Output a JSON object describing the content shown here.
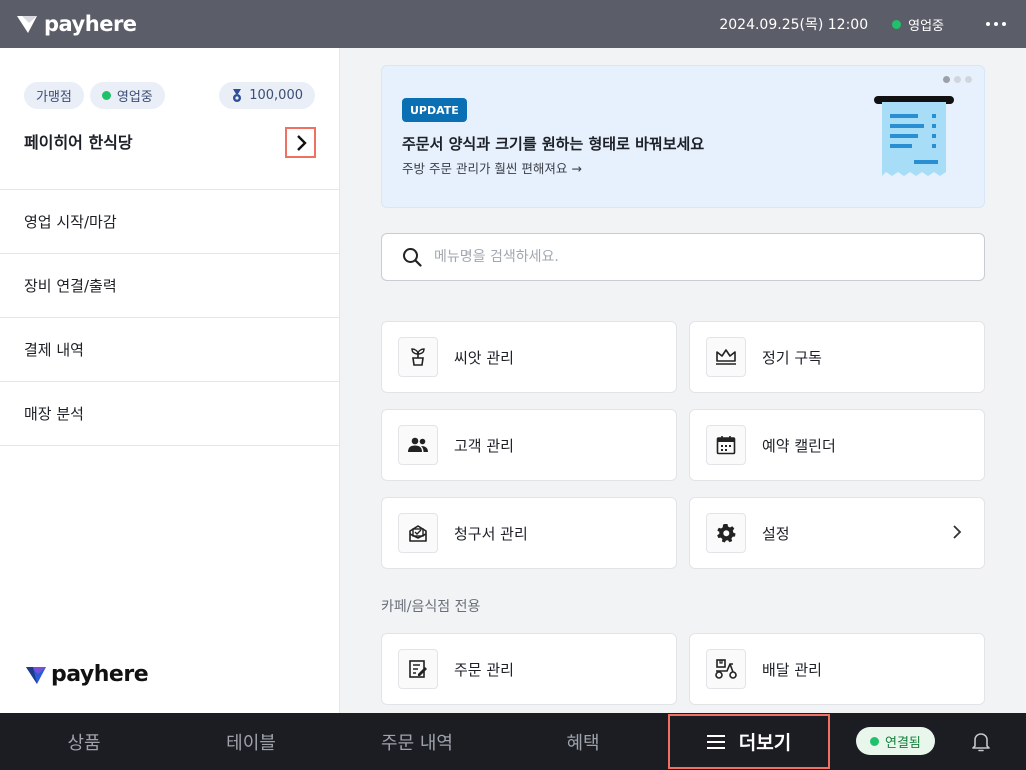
{
  "topbar": {
    "brand": "payhere",
    "datetime": "2024.09.25(목) 12:00",
    "status": "영업중"
  },
  "sidebar": {
    "badges": {
      "franchise": "가맹점",
      "status": "영업중",
      "points": "100,000"
    },
    "store_name": "페이히어 한식당",
    "items": [
      {
        "label": "영업 시작/마감"
      },
      {
        "label": "장비 연결/출력"
      },
      {
        "label": "결제 내역"
      },
      {
        "label": "매장 분석"
      }
    ],
    "footer_brand": "payhere"
  },
  "banner": {
    "tag": "UPDATE",
    "title": "주문서 양식과 크기를 원하는 형태로 바꿔보세요",
    "subtitle": "주방 주문 관리가 훨씬 편해져요 →"
  },
  "search": {
    "placeholder": "메뉴명을 검색하세요."
  },
  "cards": [
    {
      "label": "씨앗 관리",
      "icon": "sprout-icon"
    },
    {
      "label": "정기 구독",
      "icon": "crown-icon"
    },
    {
      "label": "고객 관리",
      "icon": "people-icon"
    },
    {
      "label": "예약 캘린더",
      "icon": "calendar-icon"
    },
    {
      "label": "청구서 관리",
      "icon": "invoice-icon"
    },
    {
      "label": "설정",
      "icon": "gear-icon"
    }
  ],
  "section": {
    "title": "카페/음식점 전용",
    "cards": [
      {
        "label": "주문 관리",
        "icon": "order-edit-icon"
      },
      {
        "label": "배달 관리",
        "icon": "scooter-icon"
      }
    ]
  },
  "bottomnav": {
    "tabs": [
      "상품",
      "테이블",
      "주문 내역",
      "혜택"
    ],
    "more": "더보기",
    "connection": "연결됨"
  },
  "colors": {
    "highlight": "#f07062",
    "accent_green": "#1fc16b",
    "update_tag": "#0b6fb3"
  }
}
